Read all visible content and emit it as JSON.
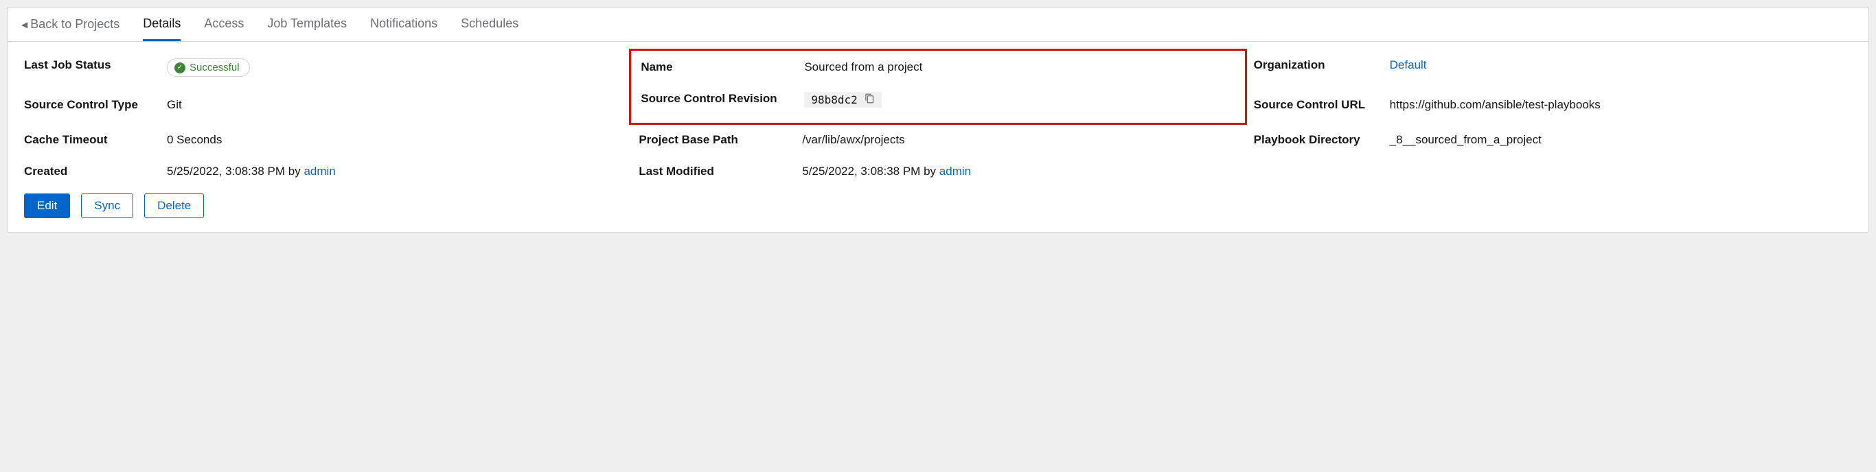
{
  "nav": {
    "back": "Back to Projects",
    "tabs": {
      "details": "Details",
      "access": "Access",
      "job_templates": "Job Templates",
      "notifications": "Notifications",
      "schedules": "Schedules"
    }
  },
  "fields": {
    "last_job_status": {
      "label": "Last Job Status",
      "value": "Successful"
    },
    "name": {
      "label": "Name",
      "value": "Sourced from a project"
    },
    "organization": {
      "label": "Organization",
      "value": "Default"
    },
    "source_control_type": {
      "label": "Source Control Type",
      "value": "Git"
    },
    "source_control_revision": {
      "label": "Source Control Revision",
      "value": "98b8dc2"
    },
    "source_control_url": {
      "label": "Source Control URL",
      "value": "https://github.com/ansible/test-playbooks"
    },
    "cache_timeout": {
      "label": "Cache Timeout",
      "value": "0 Seconds"
    },
    "project_base_path": {
      "label": "Project Base Path",
      "value": "/var/lib/awx/projects"
    },
    "playbook_directory": {
      "label": "Playbook Directory",
      "value": "_8__sourced_from_a_project"
    },
    "created": {
      "label": "Created",
      "datetime": "5/25/2022, 3:08:38 PM",
      "by": "by",
      "user": "admin"
    },
    "last_modified": {
      "label": "Last Modified",
      "datetime": "5/25/2022, 3:08:38 PM",
      "by": "by",
      "user": "admin"
    }
  },
  "actions": {
    "edit": "Edit",
    "sync": "Sync",
    "delete": "Delete"
  }
}
